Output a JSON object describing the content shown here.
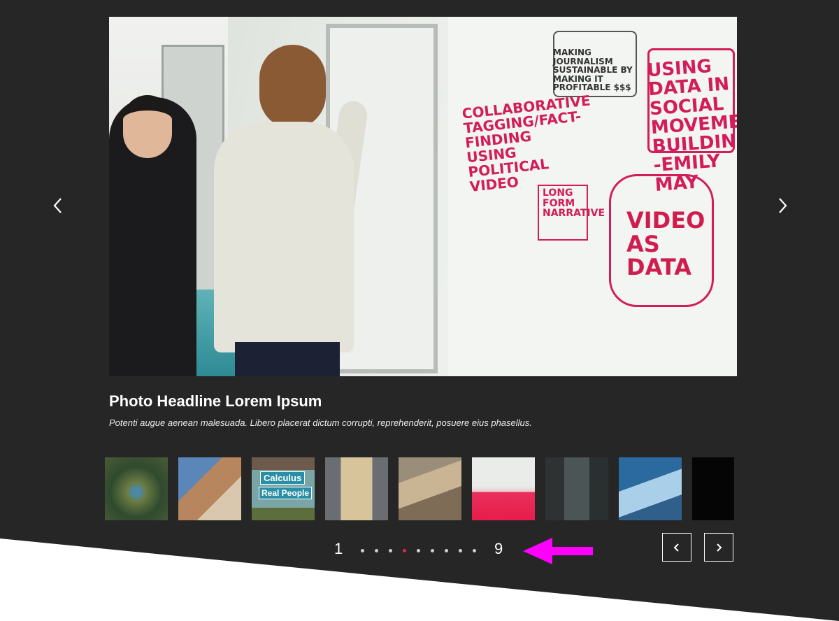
{
  "slide": {
    "headline": "Photo Headline Lorem Ipsum",
    "caption": "Potenti augue aenean malesuada. Libero placerat dictum corrupti, reprehenderit, posuere eius phasellus.",
    "whiteboard_text": {
      "using_data": "USING DATA IN SOCIAL MOVEMENT BUILDING -EMILY MAY",
      "collaborative": "COLLABORATIVE TAGGING/FACT-FINDING USING POLITICAL VIDEO",
      "long_form": "LONG FORM NARRATIVE",
      "video_as_data": "VIDEO AS DATA",
      "making_journalism": "MAKING JOURNALISM SUSTAINABLE BY MAKING IT PROFITABLE $$$"
    }
  },
  "thumbnails": [
    {
      "subject": "peacock"
    },
    {
      "subject": "building"
    },
    {
      "subject": "calculus sign",
      "text_line1": "Calculus",
      "text_line2": "Real People"
    },
    {
      "subject": "hallway"
    },
    {
      "subject": "atrium"
    },
    {
      "subject": "whiteboard",
      "active": true
    },
    {
      "subject": "chalkboard lecture"
    },
    {
      "subject": "iceberg"
    },
    {
      "subject": "dark"
    }
  ],
  "pagination": {
    "first": "1",
    "last": "9",
    "total_dots": 9,
    "active_index": 4
  },
  "icons": {
    "side_prev": "chevron-left-icon",
    "side_next": "chevron-right-icon",
    "nav_prev": "chevron-left-icon",
    "nav_next": "chevron-right-icon",
    "annotation": "arrow-left-icon"
  },
  "colors": {
    "background": "#262626",
    "accent": "#e0284f",
    "annotation": "#ff00ff",
    "text": "#ffffff"
  }
}
